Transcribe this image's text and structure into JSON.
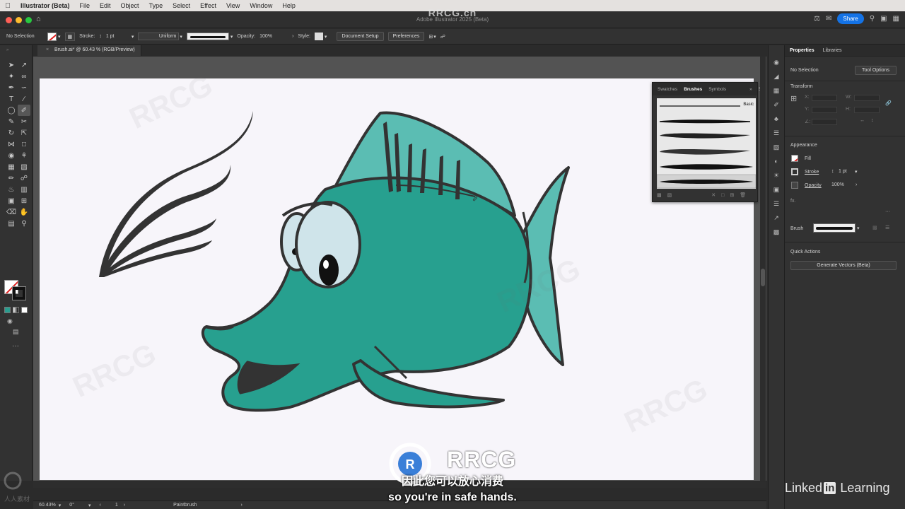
{
  "menubar": {
    "app": "Illustrator (Beta)",
    "items": [
      "File",
      "Edit",
      "Object",
      "Type",
      "Select",
      "Effect",
      "View",
      "Window",
      "Help"
    ]
  },
  "titlebar": {
    "title": "Adobe Illustrator 2025 (Beta)",
    "share": "Share"
  },
  "control": {
    "selection": "No Selection",
    "stroke_label": "Stroke:",
    "stroke_value": "1 pt",
    "profile": "Uniform",
    "opacity_label": "Opacity:",
    "opacity_value": "100%",
    "style_label": "Style:",
    "document_setup": "Document Setup",
    "preferences": "Preferences"
  },
  "document_tab": {
    "name": "Brush.ai* @ 60.43 % (RGB/Preview)"
  },
  "brushes_panel": {
    "tabs": [
      "Swatches",
      "Brushes",
      "Symbols"
    ],
    "active_tab": "Brushes",
    "first_brush_label": "Basic"
  },
  "properties": {
    "tabs": [
      "Properties",
      "Libraries"
    ],
    "selection": "No Selection",
    "tool_options": "Tool Options",
    "transform": "Transform",
    "x_label": "X:",
    "y_label": "Y:",
    "w_label": "W:",
    "h_label": "H:",
    "angle_label": "∠:",
    "appearance": "Appearance",
    "fill": "Fill",
    "stroke": "Stroke",
    "stroke_value": "1 pt",
    "opacity": "Opacity",
    "opacity_value": "100%",
    "fx": "fx.",
    "brush_label": "Brush",
    "quick_actions": "Quick Actions",
    "generate_vectors": "Generate Vectors (Beta)"
  },
  "status": {
    "zoom": "60.43%",
    "rotation": "0°",
    "artboard": "1",
    "tool": "Paintbrush"
  },
  "overlay": {
    "watermark_top": "RRCG.cn",
    "logo_text": "RRCG",
    "subtitle_cn": "因此您可以放心消费",
    "subtitle_en": "so you're in safe hands.",
    "linkedin_left": "Linked",
    "linkedin_in": "in",
    "linkedin_right": "Learning",
    "corner_logo_text": "人人素材"
  },
  "colors": {
    "fish_body": "#27a08f",
    "fish_fin": "#5bbdb3",
    "outline": "#333333",
    "eye_white": "#cfe4ea",
    "artboard": "#f7f5fa",
    "accent": "#1473e6"
  }
}
